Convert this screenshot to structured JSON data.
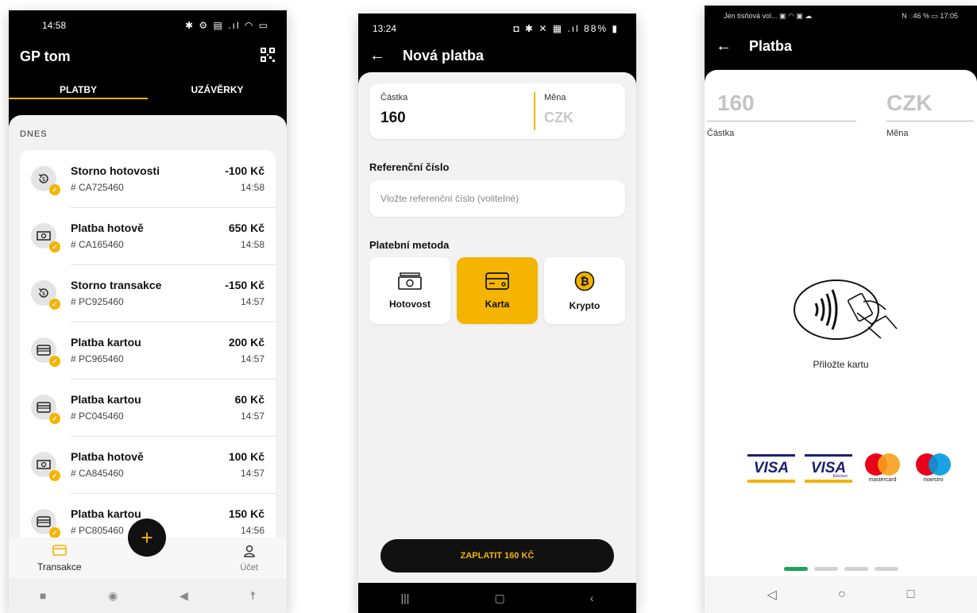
{
  "screen1": {
    "status": {
      "time": "14:58",
      "icons": "✱ ⚙ ▤ .ıl ◠ ▭"
    },
    "app_title": "GP tom",
    "tabs": [
      {
        "label": "PLATBY"
      },
      {
        "label": "UZÁVĚRKY"
      }
    ],
    "section_label": "DNES",
    "transactions": [
      {
        "title": "Storno hotovosti",
        "ref": "# CA725460",
        "amount": "-100 Kč",
        "time": "14:58",
        "icon": "refund-icon"
      },
      {
        "title": "Platba hotově",
        "ref": "# CA165460",
        "amount": "650 Kč",
        "time": "14:58",
        "icon": "cash-icon"
      },
      {
        "title": "Storno transakce",
        "ref": "# PC925460",
        "amount": "-150 Kč",
        "time": "14:57",
        "icon": "refund-icon"
      },
      {
        "title": "Platba kartou",
        "ref": "# PC965460",
        "amount": "200 Kč",
        "time": "14:57",
        "icon": "card-icon"
      },
      {
        "title": "Platba kartou",
        "ref": "# PC045460",
        "amount": "60 Kč",
        "time": "14:57",
        "icon": "card-icon"
      },
      {
        "title": "Platba hotově",
        "ref": "# CA845460",
        "amount": "100 Kč",
        "time": "14:57",
        "icon": "cash-icon"
      },
      {
        "title": "Platba kartou",
        "ref": "# PC805460",
        "amount": "150 Kč",
        "time": "14:56",
        "icon": "card-icon"
      }
    ],
    "nav": {
      "transactions": "Transakce",
      "account": "Účet"
    },
    "fab_label": "+"
  },
  "screen2": {
    "status": {
      "time": "13:24",
      "icons": "◘ ✱ ✕ ▦ .ıl 88% ▮"
    },
    "title": "Nová platba",
    "amount_label": "Částka",
    "amount_value": "160",
    "currency_label": "Měna",
    "currency_value": "CZK",
    "ref_label": "Referenční číslo",
    "ref_placeholder": "Vložte referenční číslo (volitelné)",
    "method_label": "Platební metoda",
    "methods": [
      {
        "label": "Hotovost",
        "selected": false
      },
      {
        "label": "Karta",
        "selected": true
      },
      {
        "label": "Krypto",
        "selected": false
      }
    ],
    "pay_button": "ZAPLATIT 160 KČ"
  },
  "screen3": {
    "status": {
      "left": "Jen tísňová vol... ▣ ◠ ▣ ☁",
      "right": "N ◌46 % ▭ 17:05"
    },
    "title": "Platba",
    "amount_value": "160",
    "amount_label": "Částka",
    "currency_value": "CZK",
    "currency_label": "Měna",
    "tap_label": "Přiložte kartu",
    "card_logos": [
      "VISA",
      "VISA",
      "mastercard",
      "maestro"
    ],
    "visa_electron_sub": "Electron",
    "pager": {
      "count": 4,
      "active": 0
    }
  },
  "colors": {
    "accent": "#F5B400",
    "dark": "#111111",
    "success": "#1AA55A"
  }
}
